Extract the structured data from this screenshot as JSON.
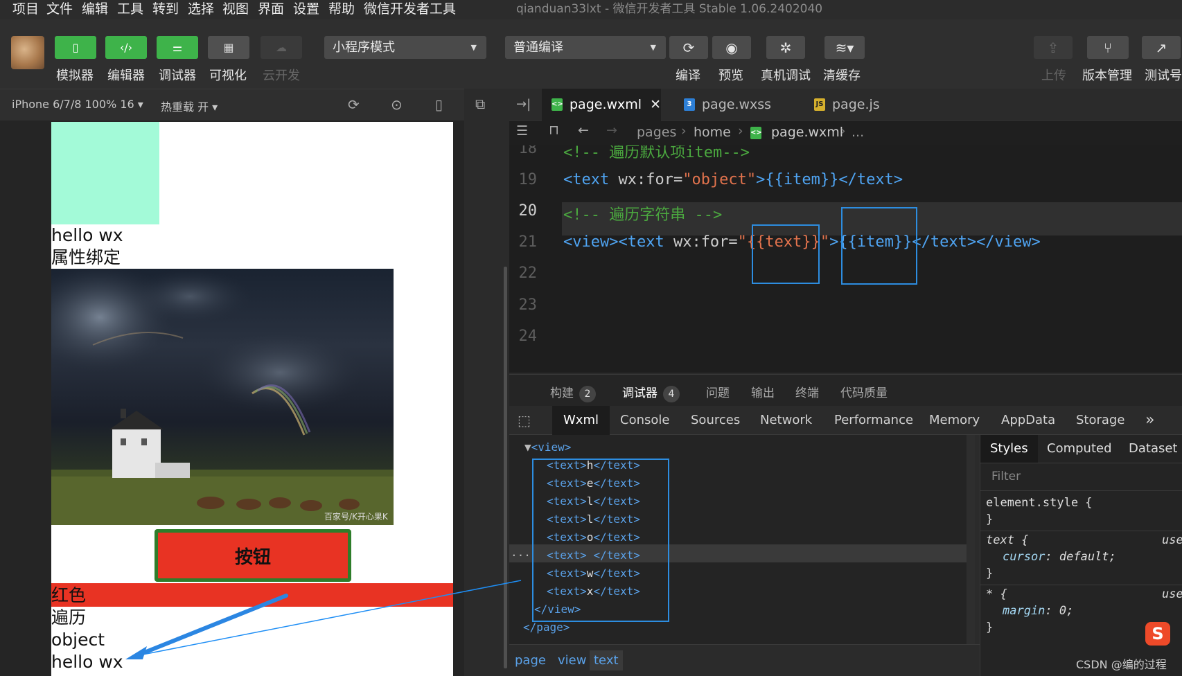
{
  "menubar": {
    "items": [
      "项目",
      "文件",
      "编辑",
      "工具",
      "转到",
      "选择",
      "视图",
      "界面",
      "设置",
      "帮助",
      "微信开发者工具"
    ],
    "title": "qianduan33lxt - 微信开发者工具 Stable 1.06.2402040"
  },
  "toolbar": {
    "simulator": "模拟器",
    "editor": "编辑器",
    "debugger": "调试器",
    "visual": "可视化",
    "cloud": "云开发",
    "mode": "小程序模式",
    "compile_mode": "普通编译",
    "compile": "编译",
    "preview": "预览",
    "real_debug": "真机调试",
    "clear_cache": "清缓存",
    "upload": "上传",
    "version": "版本管理",
    "test": "测试号"
  },
  "simulator": {
    "device": "iPhone 6/7/8 100% 16",
    "hot_reload": "热重载 开",
    "texts": {
      "hello": "hello wx",
      "bind": "属性绑定",
      "button": "按钮",
      "red": "红色",
      "loop": "遍历",
      "object": "object",
      "hello2": "hello wx"
    },
    "watermark": "百家号/K开心果K"
  },
  "editor": {
    "tabs": [
      {
        "label": "page.wxml",
        "active": true
      },
      {
        "label": "page.wxss",
        "active": false
      },
      {
        "label": "page.js",
        "active": false
      }
    ],
    "breadcrumb": [
      "pages",
      "home",
      "page.wxml",
      "..."
    ],
    "line_numbers": [
      "18",
      "19",
      "20",
      "21",
      "22",
      "23",
      "24"
    ],
    "lines": {
      "l18_comment": "<!-- 遍历默认项item-->",
      "l19_a": "<text ",
      "l19_attr": "wx:for=",
      "l19_str": "\"object\"",
      "l19_b": ">{{item}}</text>",
      "l20_comment": "<!-- 遍历字符串 -->",
      "l21_a": "<view><text ",
      "l21_attr": "wx:for=",
      "l21_q1": "\"",
      "l21_var": "{{text}}",
      "l21_q2": "\"",
      "l21_b": ">{{item}}</text></view>"
    }
  },
  "bottom_tabs": {
    "build": "构建",
    "build_count": "2",
    "debugger": "调试器",
    "debugger_count": "4",
    "issues": "问题",
    "output": "输出",
    "terminal": "终端",
    "quality": "代码质量"
  },
  "devtools": {
    "tabs": [
      "Wxml",
      "Console",
      "Sources",
      "Network",
      "Performance",
      "Memory",
      "AppData",
      "Storage"
    ],
    "more": "»",
    "wxml": {
      "open_view": "<view>",
      "rows": [
        {
          "open": "<text>",
          "ch": "h",
          "close": "</text>"
        },
        {
          "open": "<text>",
          "ch": "e",
          "close": "</text>"
        },
        {
          "open": "<text>",
          "ch": "l",
          "close": "</text>"
        },
        {
          "open": "<text>",
          "ch": "l",
          "close": "</text>"
        },
        {
          "open": "<text>",
          "ch": "o",
          "close": "</text>"
        },
        {
          "open": "<text>",
          "ch": " ",
          "close": "</text>"
        },
        {
          "open": "<text>",
          "ch": "w",
          "close": "</text>"
        },
        {
          "open": "<text>",
          "ch": "x",
          "close": "</text>"
        }
      ],
      "close_view": "</view>",
      "close_page": "</page>",
      "ellipsis": "..."
    },
    "styles": {
      "tabs": [
        "Styles",
        "Computed",
        "Dataset"
      ],
      "filter": "Filter",
      "rule1_sel": "element.style {",
      "rule1_end": "}",
      "rule2_sel": "text {",
      "rule2_src": "use",
      "rule2_prop": "cursor",
      "rule2_val": ": default;",
      "rule2_end": "}",
      "rule3_sel": "* {",
      "rule3_src": "use",
      "rule3_prop": "margin",
      "rule3_val": ": 0;",
      "rule3_end": "}"
    },
    "element_path": [
      "page",
      "view",
      "text"
    ]
  },
  "watermark": "CSDN @编的过程",
  "colors": {
    "accent_green": "#3eb34a",
    "highlight_blue": "#2d8de0",
    "phone_red": "#e83323",
    "mint": "#a3fad8"
  }
}
